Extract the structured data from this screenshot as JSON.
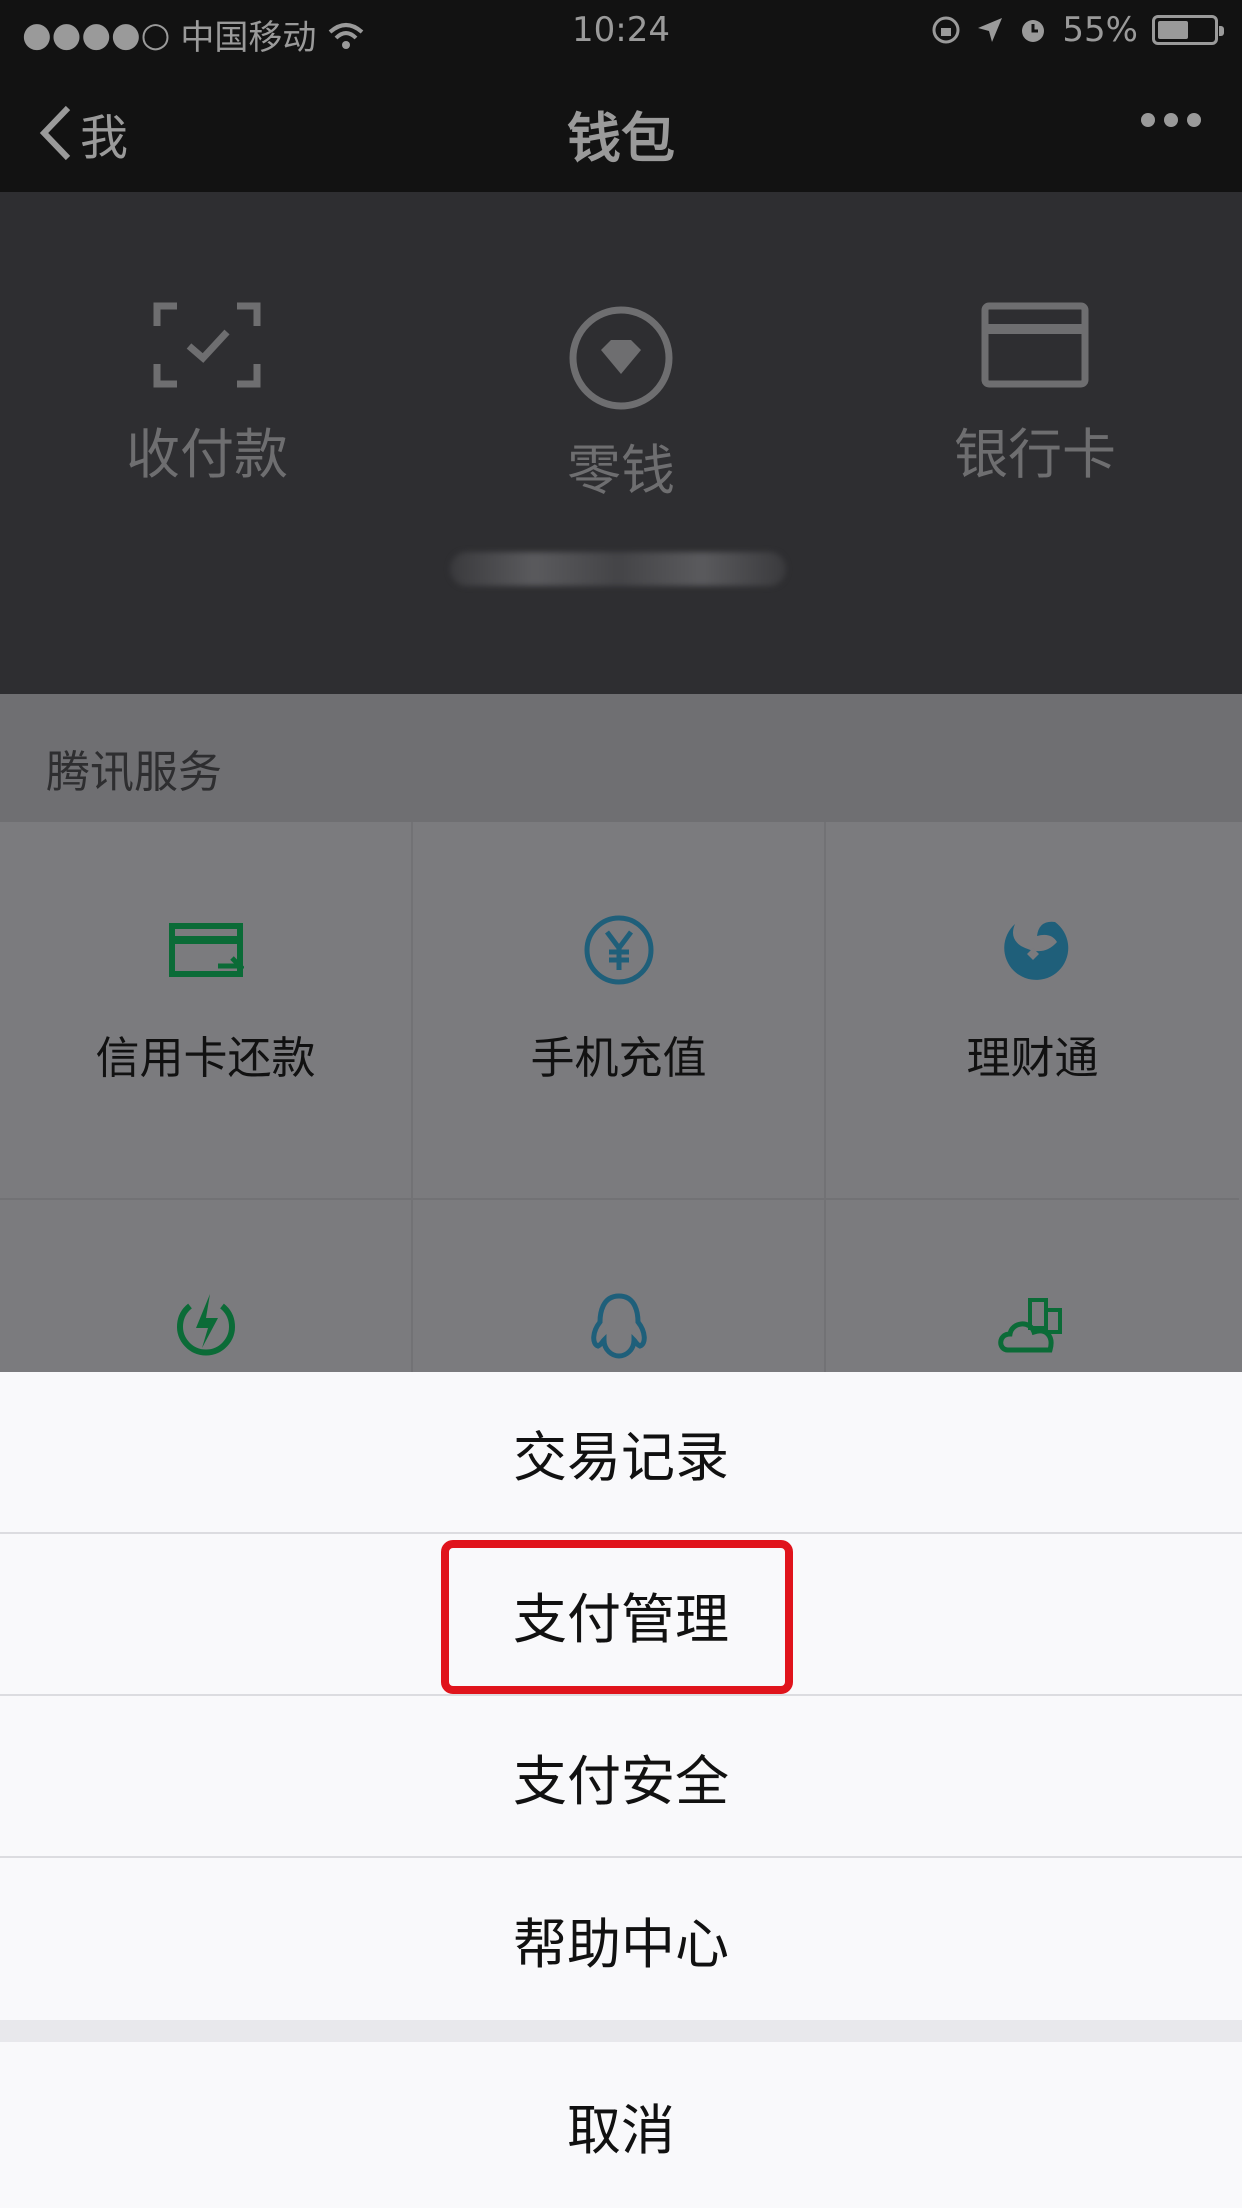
{
  "status_bar": {
    "signal": "●●●●○",
    "carrier": "中国移动",
    "time": "10:24",
    "battery": "55%",
    "battery_level": 0.55
  },
  "nav": {
    "back_label": "我",
    "title": "钱包",
    "more_icon": "more-dots-icon"
  },
  "wallet_header": {
    "items": [
      {
        "label": "收付款",
        "icon": "scan-pay-icon"
      },
      {
        "label": "零钱",
        "icon": "diamond-coin-icon"
      },
      {
        "label": "银行卡",
        "icon": "bank-card-icon"
      }
    ]
  },
  "services": {
    "title": "腾讯服务",
    "items": [
      {
        "label": "信用卡还款",
        "icon": "credit-card-icon",
        "color": "#0b6b37"
      },
      {
        "label": "手机充值",
        "icon": "yen-coin-icon",
        "color": "#1f5f7a"
      },
      {
        "label": "理财通",
        "icon": "licaitong-icon",
        "color": "#1f5f7a"
      },
      {
        "label": "",
        "icon": "lightning-icon",
        "color": "#0b6b37"
      },
      {
        "label": "",
        "icon": "qq-penguin-icon",
        "color": "#1f5f7a"
      },
      {
        "label": "",
        "icon": "city-cloud-icon",
        "color": "#0b6b37"
      }
    ]
  },
  "action_sheet": {
    "items": [
      "交易记录",
      "支付管理",
      "支付安全",
      "帮助中心"
    ],
    "cancel": "取消",
    "highlighted": "支付管理",
    "highlight_color": "#e0141c"
  }
}
